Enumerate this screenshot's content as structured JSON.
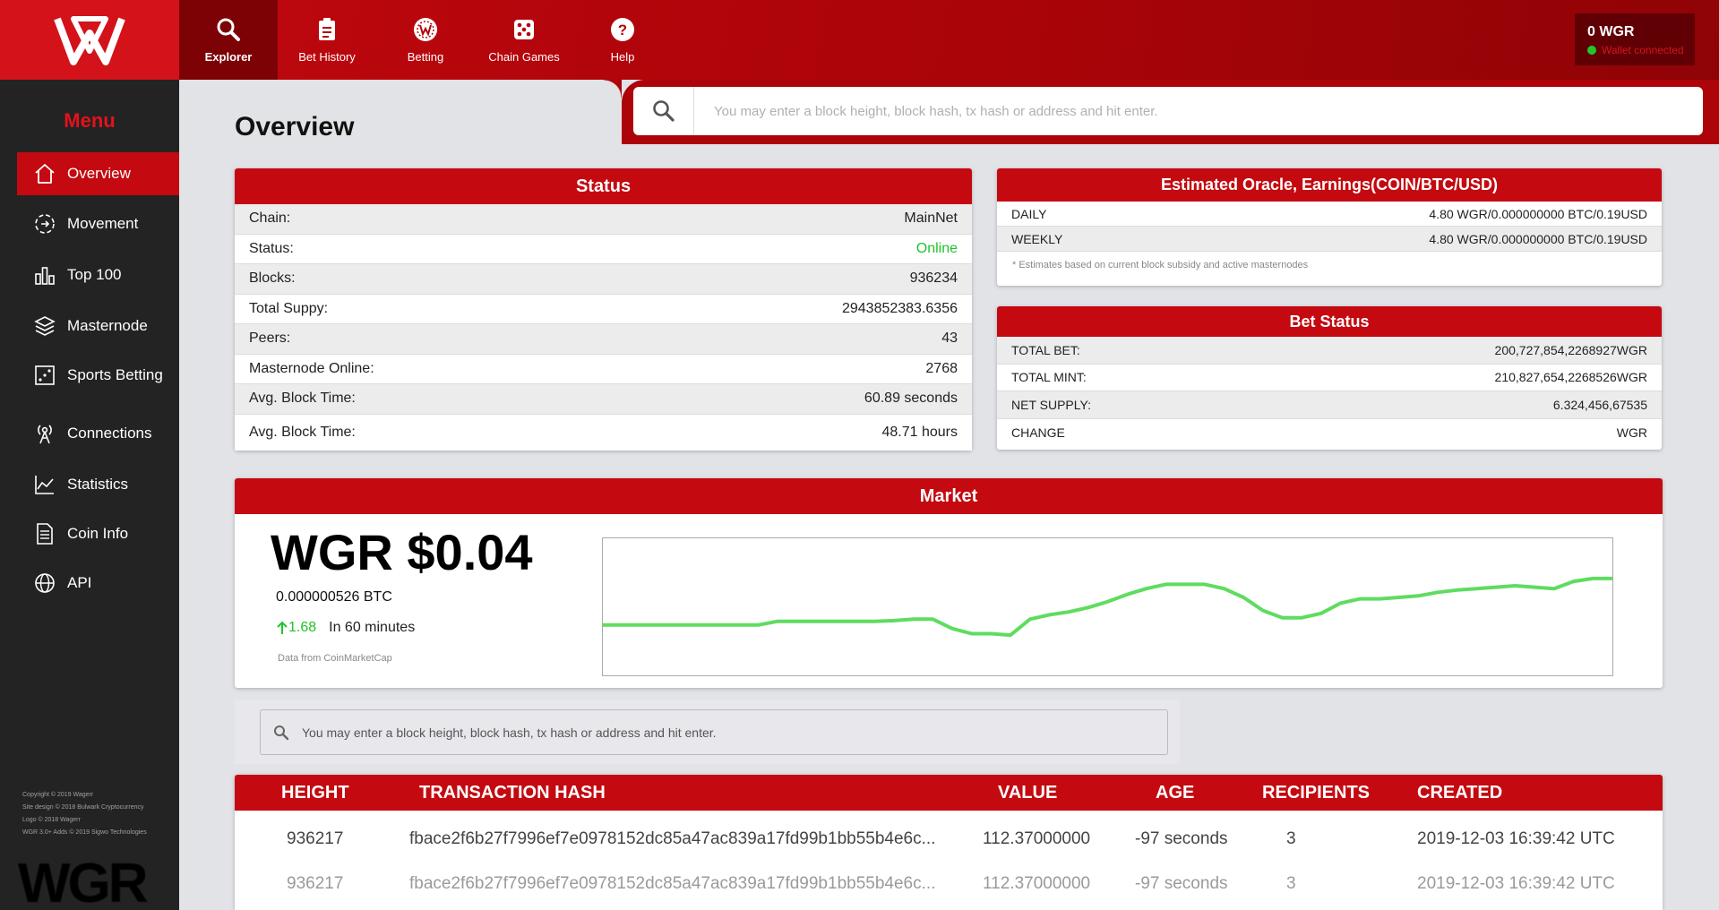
{
  "app": {
    "logo_icon": "wagerr-w-logo",
    "brand_color": "#c40910"
  },
  "nav": {
    "items": [
      {
        "label": "Explorer",
        "icon": "search-icon",
        "active": true
      },
      {
        "label": "Bet History",
        "icon": "clipboard-icon",
        "active": false
      },
      {
        "label": "Betting",
        "icon": "wagerr-badge-icon",
        "active": false
      },
      {
        "label": "Chain Games",
        "icon": "dice-icon",
        "active": false
      },
      {
        "label": "Help",
        "icon": "help-icon",
        "active": false
      }
    ]
  },
  "wallet": {
    "amount": "0 WGR",
    "status": "Wallet connected",
    "status_color": "#23c52d"
  },
  "search": {
    "placeholder": "You may enter a block height, block hash, tx hash or address and hit enter."
  },
  "sidebar": {
    "title": "Menu",
    "items": [
      {
        "label": "Overview",
        "icon": "home-icon",
        "active": true
      },
      {
        "label": "Movement",
        "icon": "movement-icon",
        "active": false
      },
      {
        "label": "Top 100",
        "icon": "bar-chart-icon",
        "active": false
      },
      {
        "label": "Masternode",
        "icon": "layers-icon",
        "active": false
      },
      {
        "label": "Sports Betting",
        "icon": "dice-icon",
        "active": false
      },
      {
        "label": "Connections",
        "icon": "antenna-icon",
        "active": false
      },
      {
        "label": "Statistics",
        "icon": "line-chart-icon",
        "active": false
      },
      {
        "label": "Coin Info",
        "icon": "document-icon",
        "active": false
      },
      {
        "label": "API",
        "icon": "globe-icon",
        "active": false
      }
    ],
    "footer": [
      "Copyright © 2019 Wagerr",
      "Site design © 2018 Bulwark Cryptocurrency",
      "Logo © 2018 Wagerr",
      "WGR 3.0+ Adds © 2019 Sigwo Technologies"
    ],
    "footer_logo": "WGR"
  },
  "page": {
    "title": "Overview"
  },
  "status": {
    "title": "Status",
    "rows": [
      {
        "label": "Chain:",
        "value": "MainNet"
      },
      {
        "label": "Status:",
        "value": "Online",
        "value_color": "#22c32a"
      },
      {
        "label": "Blocks:",
        "value": "936234"
      },
      {
        "label": "Total Suppy:",
        "value": "2943852383.6356"
      },
      {
        "label": "Peers:",
        "value": "43"
      },
      {
        "label": "Masternode Online:",
        "value": "2768"
      },
      {
        "label": "Avg. Block Time:",
        "value": "60.89 seconds"
      },
      {
        "label": "Avg. Block Time:",
        "value": "48.71 hours"
      }
    ]
  },
  "oracle": {
    "title": "Estimated Oracle, Earnings(COIN/BTC/USD)",
    "rows": [
      {
        "label": "DAILY",
        "value": "4.80 WGR/0.000000000 BTC/0.19USD"
      },
      {
        "label": "WEEKLY",
        "value": "4.80 WGR/0.000000000 BTC/0.19USD"
      }
    ],
    "note": "* Estimates based on current block subsidy and active masternodes"
  },
  "bet_status": {
    "title": "Bet Status",
    "rows": [
      {
        "label": "TOTAL BET:",
        "value": "200,727,854,2268927WGR"
      },
      {
        "label": "TOTAL MINT:",
        "value": "210,827,654,2268526WGR"
      },
      {
        "label": "NET SUPPLY:",
        "value": "6.324,456,67535"
      },
      {
        "label": "CHANGE",
        "value": "WGR"
      }
    ]
  },
  "market": {
    "title": "Market",
    "price": "WGR $0.04",
    "btc": "0.000000526 BTC",
    "change_value": "1.68",
    "change_period": "In 60 minutes",
    "change_icon": "arrow-up-icon",
    "source": "Data from CoinMarketCap",
    "line_color": "#5fdc5f"
  },
  "chart_data": {
    "type": "line",
    "title": "",
    "series": [
      {
        "values": [
          0.0,
          0.0,
          0.0,
          0.0,
          0.0,
          0.0,
          0.0,
          0.0,
          0.0,
          0.05,
          0.05,
          0.05,
          0.05,
          0.05,
          0.05,
          0.06,
          0.08,
          0.08,
          -0.05,
          -0.12,
          -0.12,
          -0.14,
          0.08,
          0.14,
          0.18,
          0.24,
          0.32,
          0.42,
          0.5,
          0.56,
          0.56,
          0.56,
          0.5,
          0.38,
          0.2,
          0.1,
          0.1,
          0.16,
          0.3,
          0.36,
          0.36,
          0.38,
          0.4,
          0.45,
          0.48,
          0.5,
          0.52,
          0.54,
          0.52,
          0.5,
          0.6,
          0.64,
          0.64
        ]
      }
    ]
  },
  "transactions": {
    "columns": [
      "HEIGHT",
      "TRANSACTION HASH",
      "VALUE",
      "AGE",
      "RECIPIENTS",
      "CREATED"
    ],
    "rows": [
      {
        "height": "936217",
        "hash": "fbace2f6b27f7996ef7e0978152dc85a47ac839a17fd99b1bb55b4e6c...",
        "value": "112.37000000",
        "age": "-97 seconds",
        "recipients": "3",
        "created": "2019-12-03 16:39:42 UTC"
      },
      {
        "height": "936217",
        "hash": "fbace2f6b27f7996ef7e0978152dc85a47ac839a17fd99b1bb55b4e6c...",
        "value": "112.37000000",
        "age": "-97 seconds",
        "recipients": "3",
        "created": "2019-12-03 16:39:42 UTC"
      }
    ]
  }
}
